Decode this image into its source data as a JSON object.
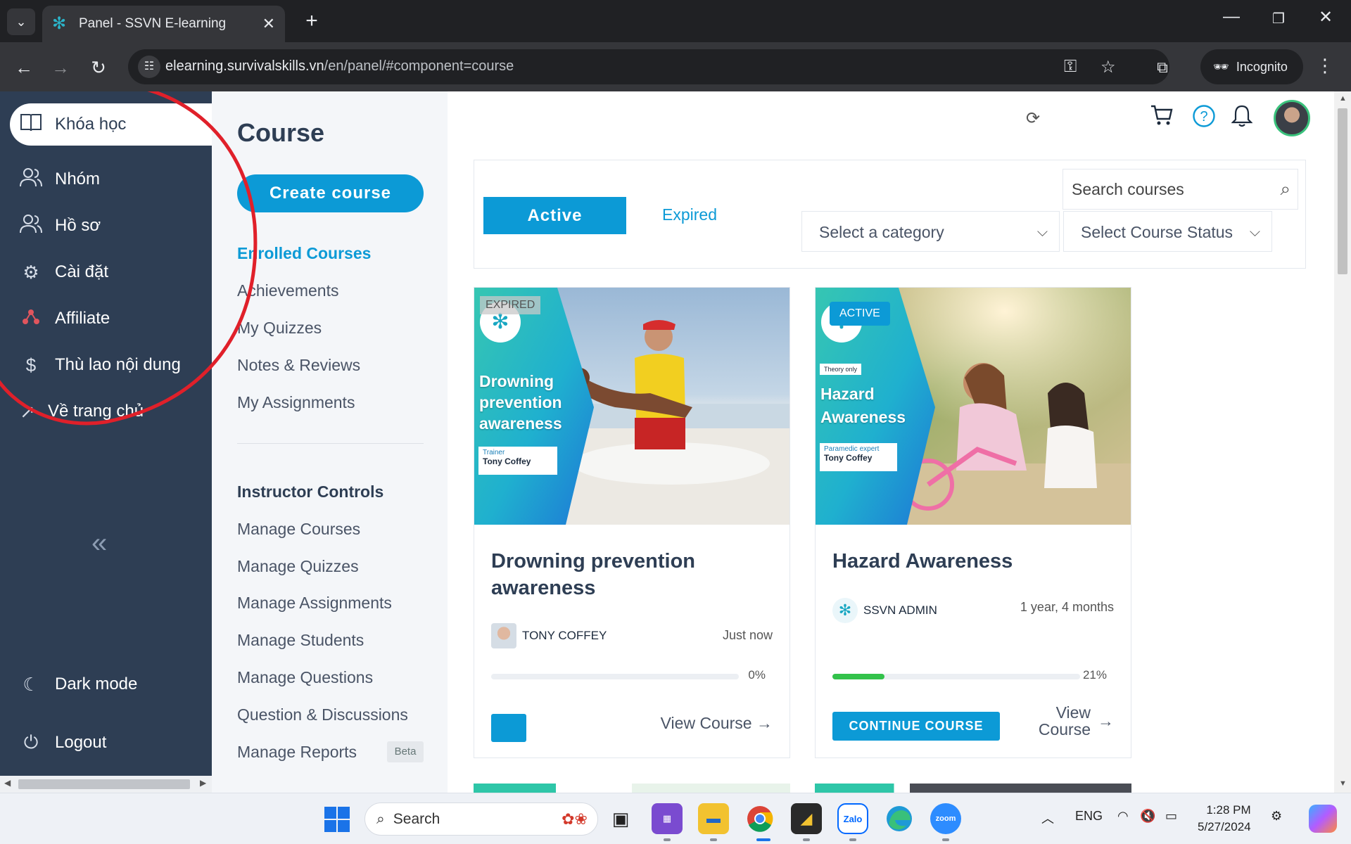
{
  "browser": {
    "tab_title": "Panel - SSVN E-learning",
    "url_host": "elearning.survivalskills.vn",
    "url_path": "/en/panel/#component=course",
    "incognito_label": "Incognito"
  },
  "sidebar": {
    "items": [
      {
        "label": "Khóa học",
        "icon": "book-icon"
      },
      {
        "label": "Nhóm",
        "icon": "users-icon"
      },
      {
        "label": "Hồ sơ",
        "icon": "users-icon"
      },
      {
        "label": "Cài đặt",
        "icon": "gear-icon"
      },
      {
        "label": "Affiliate",
        "icon": "affiliate-icon"
      },
      {
        "label": "Thù lao nội dung",
        "icon": "dollar-icon"
      },
      {
        "label": "Về trang chủ",
        "icon": "external-link-icon"
      }
    ],
    "dark_mode_label": "Dark mode",
    "logout_label": "Logout"
  },
  "subnav": {
    "title": "Course",
    "create_button": "Create course",
    "links": [
      "Enrolled Courses",
      "Achievements",
      "My Quizzes",
      "Notes & Reviews",
      "My Assignments"
    ],
    "instructor_title": "Instructor Controls",
    "instructor_links": [
      "Manage Courses",
      "Manage Quizzes",
      "Manage Assignments",
      "Manage Students",
      "Manage Questions",
      "Question & Discussions",
      "Manage Reports"
    ],
    "beta_badge": "Beta"
  },
  "filters": {
    "active_tab": "Active",
    "expired_tab": "Expired",
    "search_placeholder": "Search courses",
    "category_select": "Select a category",
    "status_select": "Select Course Status"
  },
  "courses": [
    {
      "status_tag": "EXPIRED",
      "thumb_title_lines": [
        "Drowning",
        "prevention",
        "awareness"
      ],
      "thumb_role": "Trainer",
      "thumb_name": "Tony Coffey",
      "title": "Drowning prevention awareness",
      "author": "TONY COFFEY",
      "time": "Just now",
      "progress": 0,
      "progress_label": "0%",
      "view_label": "View Course"
    },
    {
      "status_tag": "ACTIVE",
      "thumb_badge": "Theory only",
      "thumb_title_lines": [
        "Hazard",
        "Awareness"
      ],
      "thumb_role": "Paramedic expert",
      "thumb_name": "Tony Coffey",
      "title": "Hazard Awareness",
      "author": "SSVN ADMIN",
      "time": "1 year, 4 months",
      "progress": 21,
      "progress_label": "21%",
      "continue_label": "CONTINUE COURSE",
      "view_label_line1": "View",
      "view_label_line2": "Course"
    }
  ],
  "taskbar": {
    "search_label": "Search",
    "lang": "ENG",
    "time": "1:28 PM",
    "date": "5/27/2024",
    "zalo_label": "Zalo",
    "zoom_label": "zoom"
  },
  "colors": {
    "sidebar_bg": "#2e3e54",
    "accent": "#0c9ad6",
    "progress_green": "#33c24b",
    "annotation_red": "#e0202a"
  }
}
